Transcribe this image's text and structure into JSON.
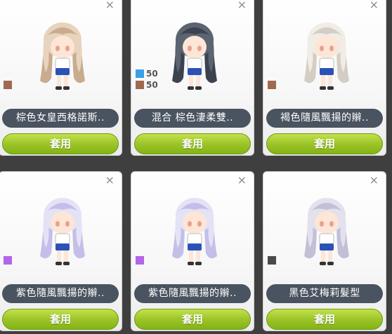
{
  "cards": [
    {
      "name": "棕色女皇西格諾斯..",
      "apply": "套用",
      "swatches": [
        {
          "color": "#a06a50",
          "pct": ""
        }
      ],
      "hair": "#e8d3bd",
      "hair_dark": "#c9ab8f"
    },
    {
      "name": "混合 棕色淒柔雙..",
      "apply": "套用",
      "swatches": [
        {
          "color": "#3aa0e8",
          "pct": "50"
        },
        {
          "color": "#a06a50",
          "pct": "50"
        }
      ],
      "hair": "#5b6470",
      "hair_dark": "#3b4250"
    },
    {
      "name": "褐色隨風飄揚的辮..",
      "apply": "套用",
      "swatches": [
        {
          "color": "#a06a50",
          "pct": ""
        }
      ],
      "hair": "#f0ece6",
      "hair_dark": "#d4cdc3"
    },
    {
      "name": "紫色隨風飄揚的辮..",
      "apply": "套用",
      "swatches": [
        {
          "color": "#b266e8",
          "pct": ""
        }
      ],
      "hair": "#e4e2f7",
      "hair_dark": "#c3bfe8"
    },
    {
      "name": "紫色隨風飄揚的辮..",
      "apply": "套用",
      "swatches": [
        {
          "color": "#b266e8",
          "pct": ""
        }
      ],
      "hair": "#e4e2f7",
      "hair_dark": "#c3bfe8"
    },
    {
      "name": "黑色艾梅莉髮型",
      "apply": "套用",
      "swatches": [
        {
          "color": "#4a4a4a",
          "pct": ""
        }
      ],
      "hair": "#e3e1ee",
      "hair_dark": "#c2bfd6"
    }
  ],
  "close_glyph": "×"
}
